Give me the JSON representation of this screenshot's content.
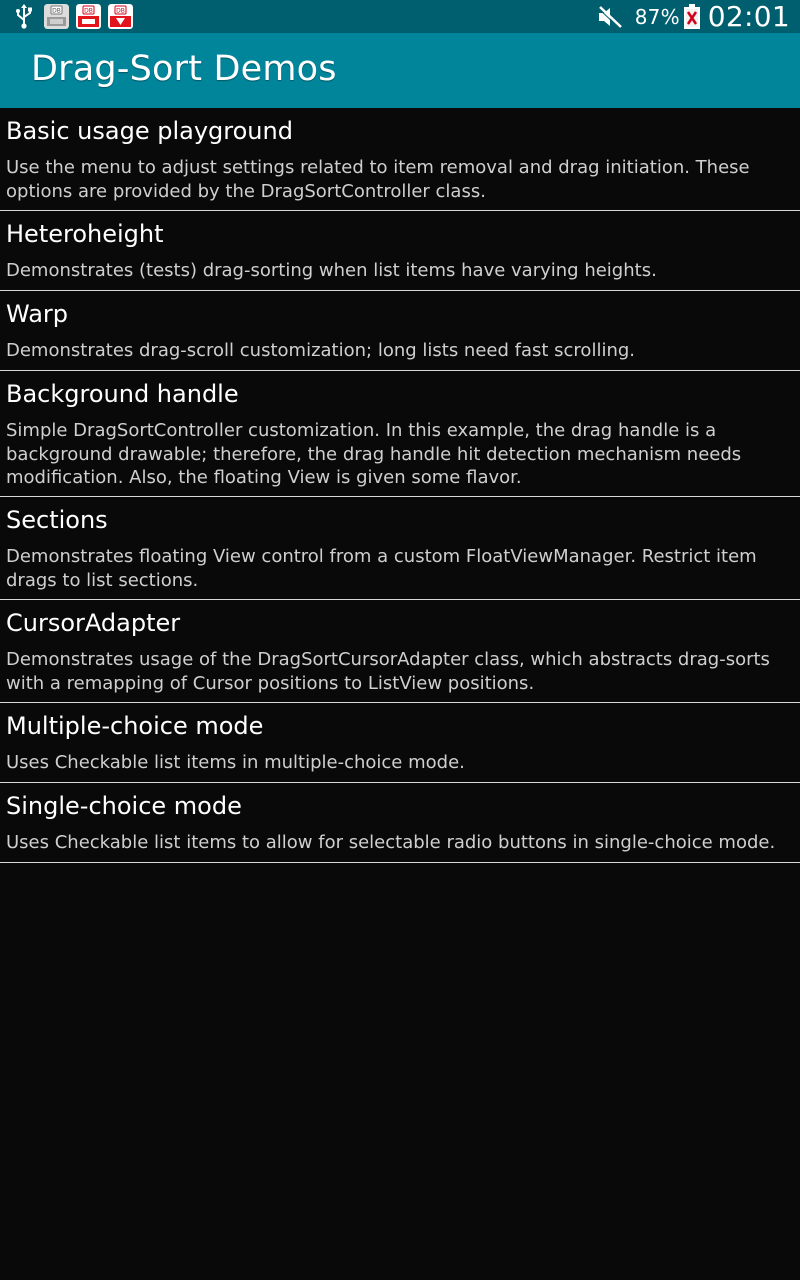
{
  "status_bar": {
    "icons_left": [
      "usb-icon",
      "notification-app-icon",
      "notification-app-icon-red",
      "notification-app-icon-red-download"
    ],
    "notification_badge": "DB",
    "mute_icon": "mute-icon",
    "battery_percent": "87%",
    "battery_icon": "battery-icon",
    "time": "02:01"
  },
  "action_bar": {
    "title": "Drag-Sort Demos",
    "color": "#00859b"
  },
  "colors": {
    "status_bar_bg": "#005f6e",
    "action_bar_bg": "#00859b",
    "list_bg": "#090909",
    "divider": "#d8d8d8"
  },
  "demos": [
    {
      "title": "Basic usage playground",
      "description": "Use the menu to adjust settings related to item removal and drag initiation. These options are provided by the DragSortController class."
    },
    {
      "title": "Heteroheight",
      "description": "Demonstrates (tests) drag-sorting when list items have varying heights."
    },
    {
      "title": "Warp",
      "description": "Demonstrates drag-scroll customization; long lists need fast scrolling."
    },
    {
      "title": "Background handle",
      "description": "Simple DragSortController customization. In this example, the drag handle is a background drawable; therefore, the drag handle hit detection mechanism needs modification. Also, the floating View is given some flavor."
    },
    {
      "title": "Sections",
      "description": "Demonstrates floating View control from a custom FloatViewManager. Restrict item drags to list sections."
    },
    {
      "title": "CursorAdapter",
      "description": "Demonstrates usage of the DragSortCursorAdapter class, which abstracts drag-sorts with a remapping of Cursor positions to ListView positions."
    },
    {
      "title": "Multiple-choice mode",
      "description": "Uses Checkable list items in multiple-choice mode."
    },
    {
      "title": "Single-choice mode",
      "description": "Uses Checkable list items to allow for selectable radio buttons in single-choice mode."
    }
  ]
}
